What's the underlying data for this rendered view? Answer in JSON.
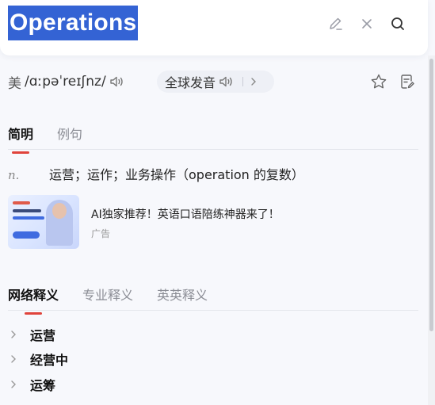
{
  "search": {
    "query": "Operations"
  },
  "pronunciation": {
    "region": "美",
    "phonetic": "/ɑːpəˈreɪʃnz/",
    "global_label": "全球发音"
  },
  "basic_tabs": [
    {
      "label": "简明",
      "active": true
    },
    {
      "label": "例句",
      "active": false
    }
  ],
  "definition": {
    "pos": "n.",
    "text": "运营；运作；业务操作（operation 的复数）"
  },
  "ad": {
    "title": "AI独家推荐！英语口语陪练神器来了！",
    "label": "广告"
  },
  "web_tabs": [
    {
      "label": "网络释义",
      "active": true
    },
    {
      "label": "专业释义",
      "active": false
    },
    {
      "label": "英英释义",
      "active": false
    }
  ],
  "web_meanings": [
    "运营",
    "经营中",
    "运筹"
  ],
  "colors": {
    "accent": "#e0433b",
    "selection": "#3463d4"
  }
}
